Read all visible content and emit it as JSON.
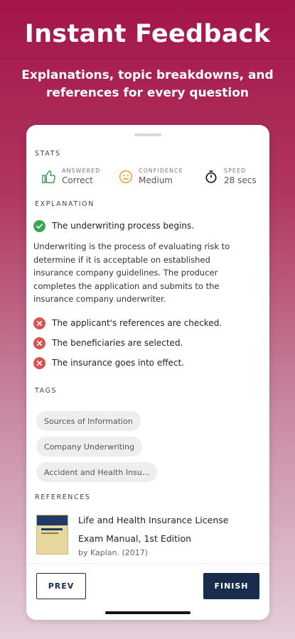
{
  "hero": {
    "title": "Instant Feedback",
    "subtitle": "Explanations, topic breakdowns, and references for every question"
  },
  "stats": {
    "section_title": "STATS",
    "answered": {
      "label": "ANSWERED",
      "value": "Correct",
      "icon": "thumbs-up-icon"
    },
    "confidence": {
      "label": "CONFIDENCE",
      "value": "Medium",
      "icon": "neutral-face-icon"
    },
    "speed": {
      "label": "SPEED",
      "value": "28 secs",
      "icon": "stopwatch-icon"
    }
  },
  "explanation": {
    "section_title": "EXPLANATION",
    "correct_answer": "The underwriting process begins.",
    "body": "Underwriting is the process of evaluating risk to determine if it is acceptable on established insurance company guidelines. The producer completes the application and submits to the  insurance company underwriter.",
    "wrong_answers": [
      "The applicant's references are checked.",
      "The beneficiaries are selected.",
      "The insurance goes into effect."
    ]
  },
  "tags": {
    "section_title": "TAGS",
    "items": [
      "Sources of Information",
      "Company Underwriting",
      "Accident and Health Insu..."
    ]
  },
  "references": {
    "section_title": "REFERENCES",
    "book_title": "Life and Health Insurance License Exam Manual, 1st Edition",
    "book_by": "by Kaplan. (2017)"
  },
  "footer": {
    "prev_label": "PREV",
    "finish_label": "FINISH"
  },
  "colors": {
    "brand": "#a3154a",
    "correct": "#3aa655",
    "wrong": "#d9534f",
    "navy": "#1a2c4e",
    "accent_green": "#3aa655",
    "accent_orange": "#e0a31b"
  }
}
